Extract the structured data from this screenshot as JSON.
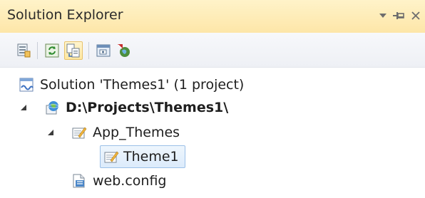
{
  "panel": {
    "title": "Solution Explorer"
  },
  "tree": {
    "solution": {
      "label": "Solution 'Themes1' (1 project)"
    },
    "project": {
      "label": "D:\\Projects\\Themes1\\"
    },
    "app_themes": {
      "label": "App_Themes"
    },
    "theme1": {
      "label": "Theme1"
    },
    "web_config": {
      "label": "web.config"
    }
  },
  "colors": {
    "titlebar": "#fde6a8",
    "selection_border": "#9bc0e8",
    "selection_fill": "#dcebfb"
  }
}
